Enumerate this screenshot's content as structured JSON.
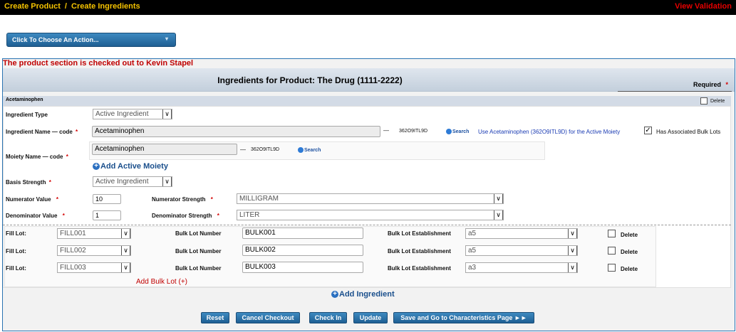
{
  "nav": {
    "breadcrumb_create_product": "Create Product",
    "breadcrumb_separator": "/",
    "breadcrumb_create_ingredients": "Create Ingredients",
    "view_validation": "View Validation"
  },
  "action_menu": {
    "label": "Click To Choose An Action...",
    "chevron": "▾"
  },
  "checkout_message": "The product section is checked out to Kevin Stapel",
  "header": {
    "title": "Ingredients for Product: The Drug (1111-2222)",
    "required": "Required",
    "required_star": "*"
  },
  "ingredient": {
    "name": "Acetaminophen",
    "delete_label": "Delete",
    "star": "*",
    "type_label": "Ingredient Type",
    "type_value": "Active Ingredient",
    "name_code_label": "Ingredient Name — code",
    "name_value": "Acetaminophen",
    "code": "362O9ITL9D",
    "search_label": "Search",
    "use_moiety_link": "Use Acetaminophen (362O9ITL9D) for the Active Moiety",
    "has_bulk_lots_label": "Has Associated Bulk Lots",
    "has_bulk_lots_checked": true,
    "moiety_label": "Moiety Name — code",
    "moiety_value": "Acetaminophen",
    "moiety_code": "362O9ITL9D",
    "moiety_search": "Search",
    "add_moiety": "Add Active Moiety",
    "basis_label": "Basis Strength",
    "basis_value": "Active Ingredient",
    "numerator_value_label": "Numerator Value",
    "numerator_value": "10",
    "numerator_strength_label": "Numerator Strength",
    "numerator_strength": "MILLIGRAM",
    "denominator_value_label": "Denominator Value",
    "denominator_value": "1",
    "denominator_strength_label": "Denominator Strength",
    "denominator_strength": "LITER"
  },
  "lots": {
    "fill_lot_label": "Fill Lot:",
    "bulk_lot_number_label": "Bulk Lot Number",
    "bulk_lot_establishment_label": "Bulk Lot Establishment",
    "delete_label": "Delete",
    "rows": [
      {
        "fill_lot": "FILL001",
        "bulk_lot": "BULK001",
        "establishment": "a5"
      },
      {
        "fill_lot": "FILL002",
        "bulk_lot": "BULK002",
        "establishment": "a5"
      },
      {
        "fill_lot": "FILL003",
        "bulk_lot": "BULK003",
        "establishment": "a3"
      }
    ],
    "add_bulk_lot": "Add Bulk Lot (+)"
  },
  "add_ingredient": "Add Ingredient",
  "buttons": {
    "reset": "Reset",
    "cancel_checkout": "Cancel Checkout",
    "check_in": "Check In",
    "update": "Update",
    "save_next": "Save and Go to Characteristics Page ►►"
  },
  "colors": {
    "accent": "#2b74b2",
    "alert": "#c00000",
    "nav_highlight": "#f5c300"
  }
}
